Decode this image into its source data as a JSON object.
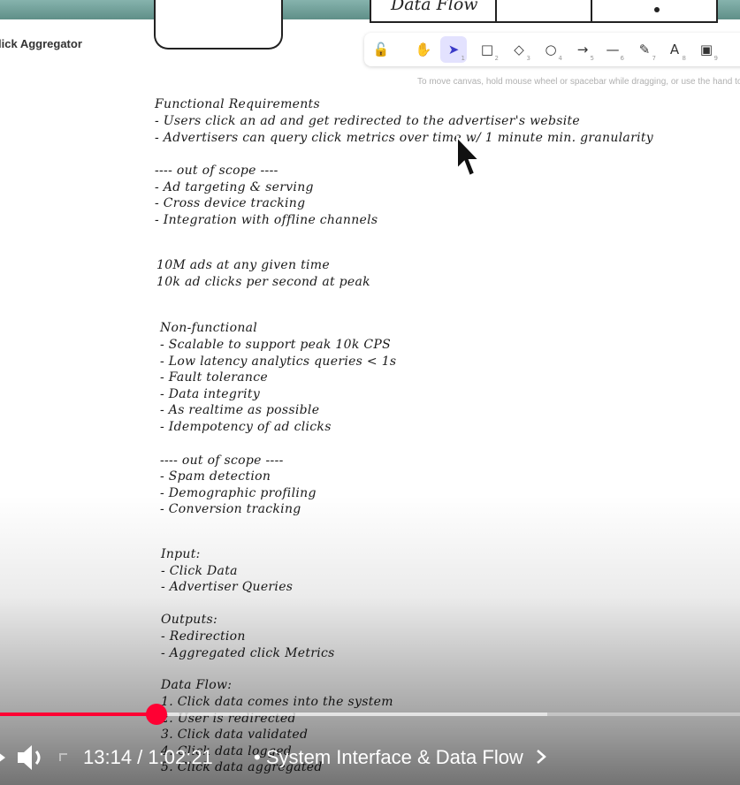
{
  "app": {
    "title": "lick Aggregator"
  },
  "canvas_top": {
    "box_label": "Data Flow"
  },
  "toolbar": {
    "tools": [
      {
        "icon": "lock-icon",
        "glyph": "🔓",
        "num": ""
      },
      {
        "icon": "hand-icon",
        "glyph": "✋",
        "num": ""
      },
      {
        "icon": "pointer-icon",
        "glyph": "➤",
        "num": "1",
        "active": true
      },
      {
        "icon": "rectangle-icon",
        "glyph": "□",
        "num": "2"
      },
      {
        "icon": "diamond-icon",
        "glyph": "◇",
        "num": "3"
      },
      {
        "icon": "ellipse-icon",
        "glyph": "○",
        "num": "4"
      },
      {
        "icon": "arrow-icon",
        "glyph": "→",
        "num": "5"
      },
      {
        "icon": "line-icon",
        "glyph": "—",
        "num": "6"
      },
      {
        "icon": "pencil-icon",
        "glyph": "✎",
        "num": "7"
      },
      {
        "icon": "text-icon",
        "glyph": "A",
        "num": "8"
      },
      {
        "icon": "image-icon",
        "glyph": "▣",
        "num": "9"
      }
    ],
    "hint": "To move canvas, hold mouse wheel or spacebar while dragging, or use the hand to"
  },
  "notes": {
    "functional_title": "Functional Requirements",
    "functional": [
      "- Users click an ad and get redirected to the advertiser's website",
      "- Advertisers can query click metrics over time w/ 1 minute min. granularity"
    ],
    "oos1_title": "---- out of scope ----",
    "oos1": [
      "- Ad targeting & serving",
      "- Cross device tracking",
      "- Integration with offline channels"
    ],
    "scale": [
      "10M ads at any given time",
      "10k ad clicks per second at peak"
    ],
    "nonfunctional_title": "Non-functional",
    "nonfunctional": [
      "- Scalable to support peak 10k CPS",
      "- Low latency analytics queries < 1s",
      "- Fault tolerance",
      "- Data integrity",
      "- As realtime as possible",
      "- Idempotency of ad clicks"
    ],
    "oos2_title": "---- out of scope ----",
    "oos2": [
      "- Spam detection",
      "- Demographic profiling",
      "- Conversion tracking"
    ],
    "input_title": "Input:",
    "input": [
      "- Click Data",
      "- Advertiser Queries"
    ],
    "outputs_title": "Outputs:",
    "outputs": [
      "- Redirection",
      "- Aggregated click Metrics"
    ],
    "dataflow_title": "Data Flow:",
    "dataflow": [
      "1. Click data comes into the system",
      "2. User is redirected",
      "3. Click data validated",
      "4. Click data logged",
      "5. Click data aggregated"
    ]
  },
  "player": {
    "time_label": "13:14 / 1:02:21",
    "chapter_label": "System Interface & Data Flow",
    "progress_fraction": 0.212,
    "buffered_fraction": 0.74,
    "accent": "#ff0033"
  }
}
